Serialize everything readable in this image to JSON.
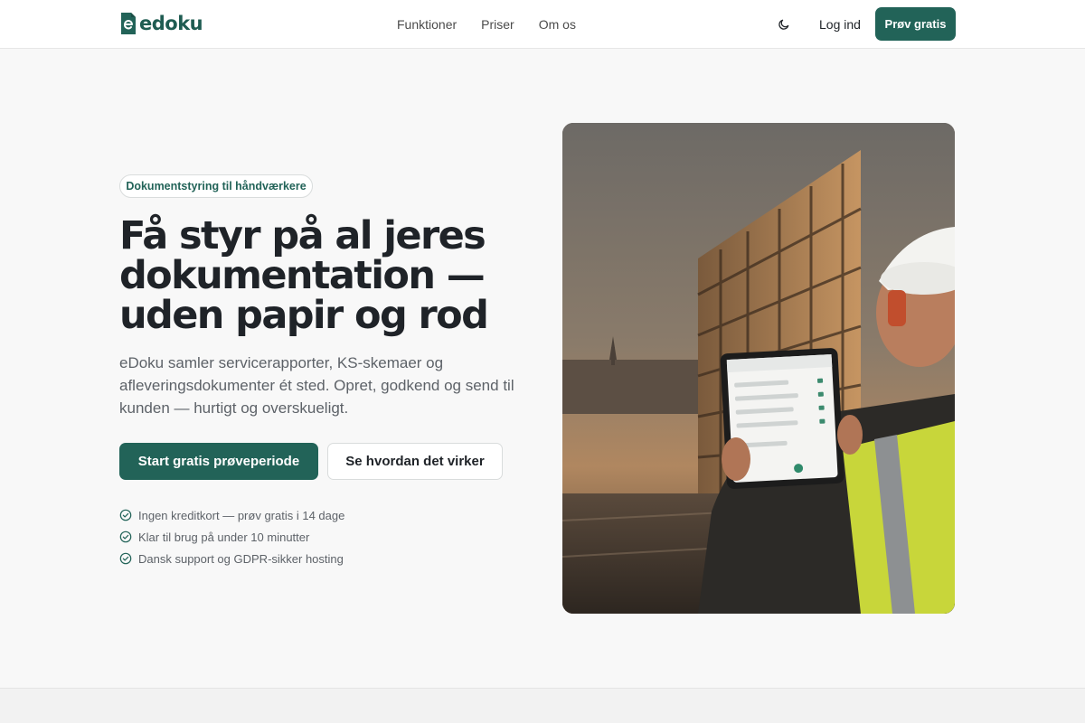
{
  "brand": {
    "name": "edoku",
    "color": "#226358"
  },
  "nav": {
    "links": [
      "Funktioner",
      "Priser",
      "Om os"
    ],
    "login_label": "Log ind",
    "cta_label": "Prøv gratis",
    "theme_toggle_icon": "moon-icon"
  },
  "hero": {
    "badge": "Dokumentstyring til håndværkere",
    "title": "Få styr på al jeres dokumentation — uden papir og rod",
    "description": "eDoku samler servicerapporter, KS-skemaer og afleveringsdokumenter ét sted. Opret, godkend og send til kunden — hurtigt og overskueligt.",
    "primary_cta": "Start gratis prøveperiode",
    "secondary_cta": "Se hvordan det virker",
    "features": [
      "Ingen kreditkort — prøv gratis i 14 dage",
      "Klar til brug på under 10 minutter",
      "Dansk support og GDPR-sikker hosting"
    ],
    "feature_icon": "check-circle-icon"
  },
  "image": {
    "subject": "construction-worker-with-tablet-photo"
  },
  "colors": {
    "accent": "#226358",
    "background": "#f8f8f8",
    "text": "#1f2328",
    "muted": "#5d6268"
  }
}
